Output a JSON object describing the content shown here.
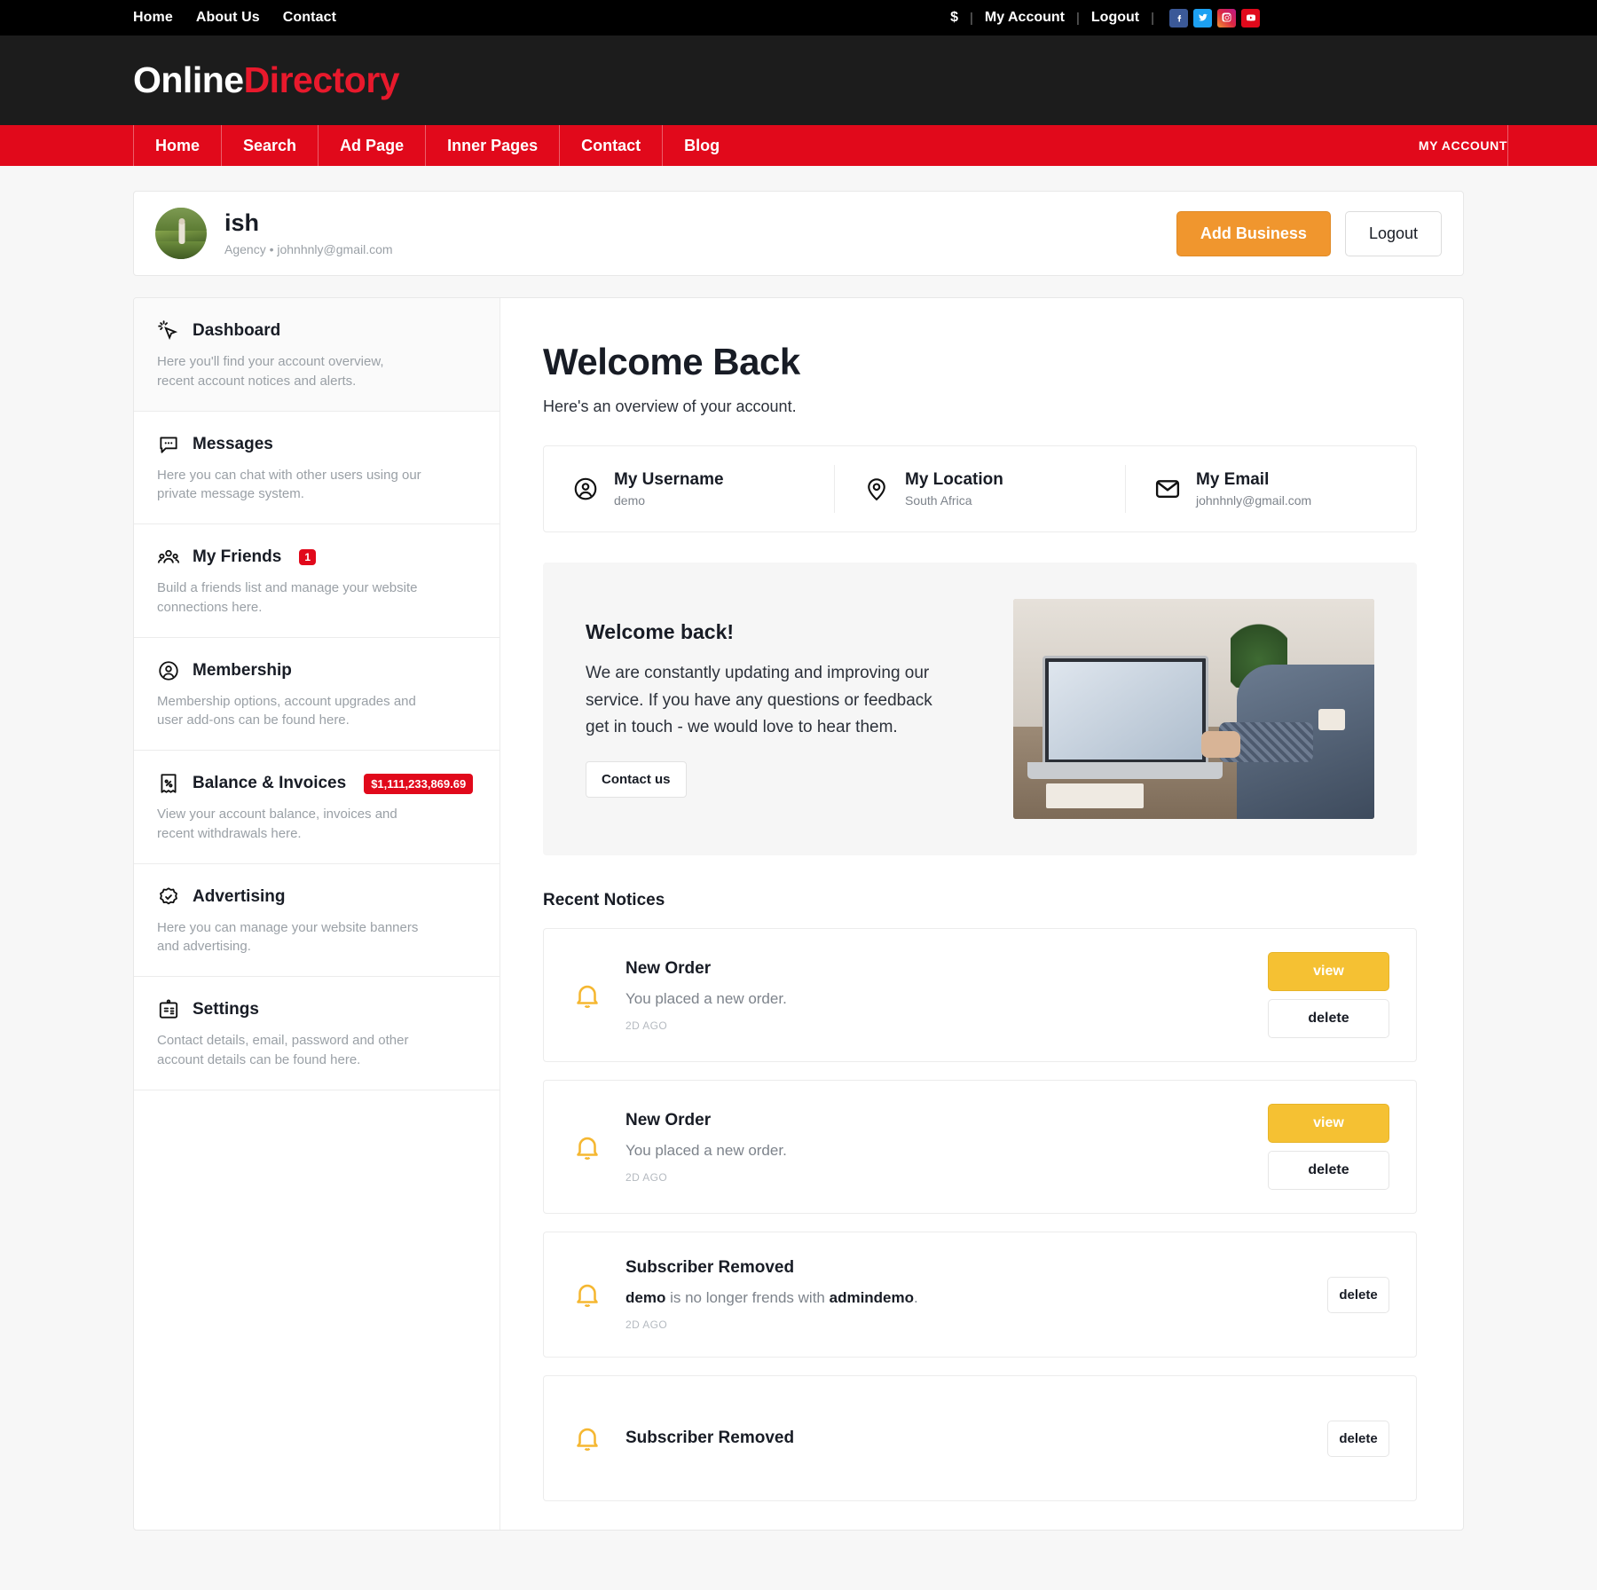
{
  "topbar": {
    "left_links": [
      "Home",
      "About Us",
      "Contact"
    ],
    "currency": "$",
    "account_link": "My Account",
    "logout_link": "Logout",
    "socials": [
      {
        "name": "facebook-icon",
        "color": "#3b5998"
      },
      {
        "name": "twitter-icon",
        "color": "#1da1f2"
      },
      {
        "name": "instagram-icon",
        "color": "#c13584"
      },
      {
        "name": "youtube-icon",
        "color": "#e1091b"
      }
    ]
  },
  "logo": {
    "part1": "Online",
    "part2": "Directory",
    "accent": "#e8192c"
  },
  "mainnav": {
    "items": [
      "Home",
      "Search",
      "Ad Page",
      "Inner Pages",
      "Contact",
      "Blog"
    ],
    "right_item": "MY ACCOUNT",
    "background": "#e1091b"
  },
  "profile": {
    "name": "ish",
    "subtitle": "Agency • johnhnly@gmail.com",
    "add_business_label": "Add Business",
    "logout_label": "Logout",
    "add_business_color": "#f0962e"
  },
  "sidebar": {
    "items": [
      {
        "label": "Dashboard",
        "icon": "cursor-click-icon",
        "desc": "Here you'll find your account overview, recent account notices and alerts.",
        "active": true
      },
      {
        "label": "Messages",
        "icon": "chat-bubble-icon",
        "desc": "Here you can chat with other users using our private message system."
      },
      {
        "label": "My Friends",
        "icon": "people-group-icon",
        "badge": "1",
        "desc": "Build a friends list and manage your website connections here."
      },
      {
        "label": "Membership",
        "icon": "user-circle-icon",
        "desc": "Membership options, account upgrades and user add-ons can be found here."
      },
      {
        "label": "Balance & Invoices",
        "icon": "receipt-percent-icon",
        "badge": "$1,111,233,869.69",
        "desc": "View your account balance, invoices and recent withdrawals here."
      },
      {
        "label": "Advertising",
        "icon": "badge-check-icon",
        "desc": "Here you can manage your website banners and advertising."
      },
      {
        "label": "Settings",
        "icon": "id-card-icon",
        "desc": "Contact details, email, password and other account details can be found here."
      }
    ],
    "badge_color": "#e1091b"
  },
  "main": {
    "heading": "Welcome Back",
    "lead": "Here's an overview of your account.",
    "stats": [
      {
        "label": "My Username",
        "value": "demo",
        "icon": "user-circle-icon"
      },
      {
        "label": "My Location",
        "value": "South Africa",
        "icon": "map-pin-icon"
      },
      {
        "label": "My Email",
        "value": "johnhnly@gmail.com",
        "icon": "envelope-icon"
      }
    ],
    "promo": {
      "heading": "Welcome back!",
      "body": "We are constantly updating and improving our service. If you have any questions or feedback get in touch - we would love to hear them.",
      "button": "Contact us",
      "image_alt": "person-working-on-laptop-photo"
    },
    "notices_heading": "Recent Notices",
    "notices": [
      {
        "title": "New Order",
        "desc": "You placed a new order.",
        "time": "2D AGO",
        "icon": "bell-icon",
        "view_label": "view",
        "delete_label": "delete"
      },
      {
        "title": "New Order",
        "desc": "You placed a new order.",
        "time": "2D AGO",
        "icon": "bell-icon",
        "view_label": "view",
        "delete_label": "delete"
      },
      {
        "title": "Subscriber Removed",
        "desc_prefix": "demo",
        "desc_middle": " is no longer frends with ",
        "desc_suffix": "admindemo",
        "desc_end": ".",
        "time": "2D AGO",
        "icon": "bell-icon",
        "delete_label": "delete"
      },
      {
        "title": "Subscriber Removed",
        "icon": "bell-icon",
        "delete_label": "delete"
      }
    ]
  }
}
